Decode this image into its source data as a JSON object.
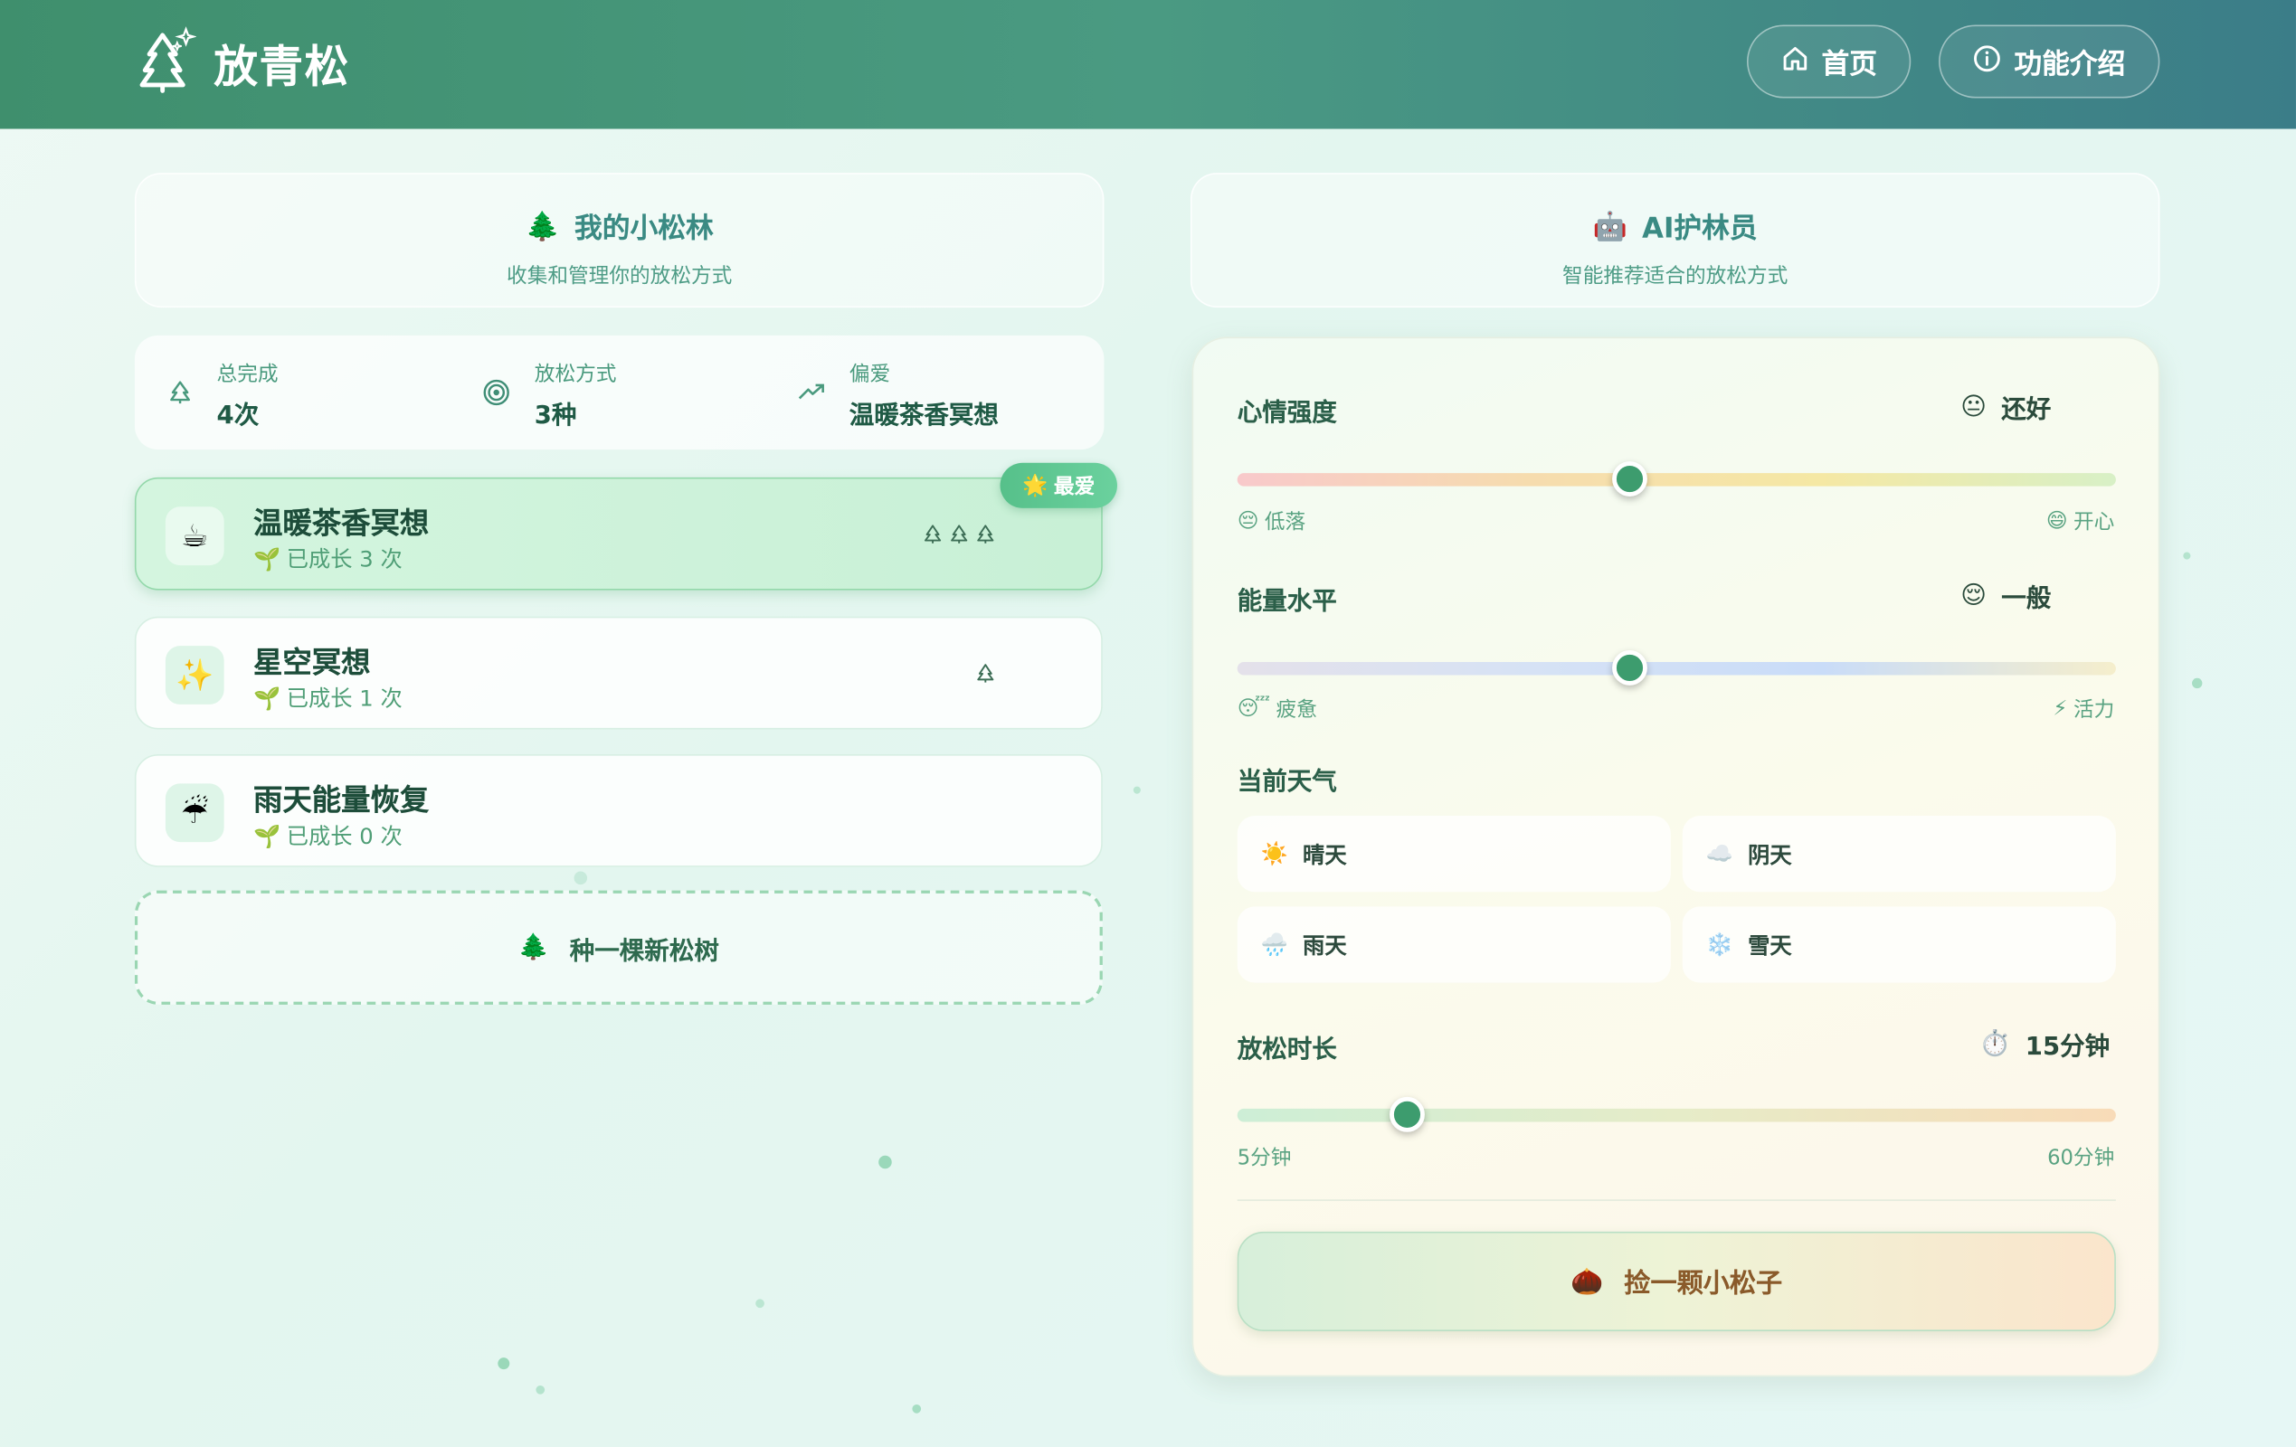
{
  "header": {
    "app_name": "放青松",
    "nav": [
      {
        "label": "首页",
        "icon": "home-icon"
      },
      {
        "label": "功能介绍",
        "icon": "info-icon"
      }
    ]
  },
  "left": {
    "section_title": "我的小松林",
    "section_icon": "🌲",
    "section_subtitle": "收集和管理你的放松方式",
    "stats": [
      {
        "label": "总完成",
        "value": "4次",
        "icon": "tree-outline-icon"
      },
      {
        "label": "放松方式",
        "value": "3种",
        "icon": "target-icon"
      },
      {
        "label": "偏爱",
        "value": "温暖茶香冥想",
        "icon": "trending-up-icon"
      }
    ],
    "methods": [
      {
        "name": "温暖茶香冥想",
        "emoji": "☕",
        "growth": "已成长 3 次",
        "trees": 3,
        "favorite": true
      },
      {
        "name": "星空冥想",
        "emoji": "✨",
        "growth": "已成长 1 次",
        "trees": 1,
        "favorite": false
      },
      {
        "name": "雨天能量恢复",
        "emoji": "☔",
        "growth": "已成长 0 次",
        "trees": 0,
        "favorite": false
      }
    ],
    "favorite_badge": "最爱",
    "favorite_badge_icon": "🌟",
    "growth_icon": "🌱",
    "plant_button": "种一棵新松树",
    "plant_icon": "🌲"
  },
  "right": {
    "section_title": "AI护林员",
    "section_icon": "🤖",
    "section_subtitle": "智能推荐适合的放松方式",
    "mood": {
      "label": "心情强度",
      "value_emoji": "😐",
      "value_text": "还好",
      "level": 0.45,
      "min_label": "低落",
      "min_emoji": "😔",
      "max_label": "开心",
      "max_emoji": "😄"
    },
    "energy": {
      "label": "能量水平",
      "value_emoji": "😌",
      "value_text": "一般",
      "level": 0.45,
      "min_label": "疲惫",
      "min_emoji": "😴",
      "max_label": "活力",
      "max_emoji": "⚡"
    },
    "weather": {
      "label": "当前天气",
      "options": [
        {
          "label": "晴天",
          "emoji": "☀️"
        },
        {
          "label": "阴天",
          "emoji": "☁️"
        },
        {
          "label": "雨天",
          "emoji": "🌧️"
        },
        {
          "label": "雪天",
          "emoji": "❄️"
        }
      ]
    },
    "duration": {
      "label": "放松时长",
      "value_emoji": "⏱️",
      "value_text": "15分钟",
      "min_label": "5分钟",
      "max_label": "60分钟",
      "value_minutes": 15
    },
    "seed_button": "捡一颗小松子",
    "seed_icon": "🌰"
  },
  "colors": {
    "header_start": "#3f8f6d",
    "header_end": "#3b7d88",
    "accent": "#3d9c6e",
    "favorite": "#56c08a"
  }
}
